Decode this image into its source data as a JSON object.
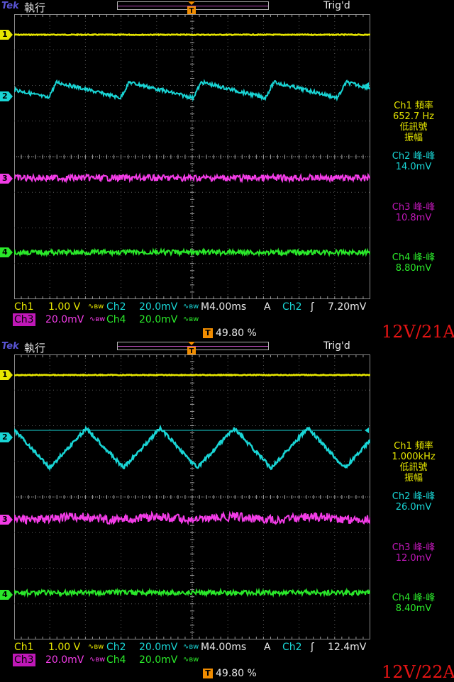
{
  "colors": {
    "ch1": "#e6e600",
    "ch2": "#19d5d5",
    "ch3": "#f23ce6",
    "ch4": "#2ae82a",
    "trigger_marker": "#f08c00",
    "caption": "#e41414"
  },
  "screens": [
    {
      "brand": "Tek",
      "run_state": "執行",
      "trig_status": "Trig'd",
      "channel_markers": [
        "1",
        "2",
        "3",
        "4"
      ],
      "measurements": {
        "ch1": {
          "title": "Ch1 頻率",
          "value": "652.7 Hz",
          "note1": "低訊號",
          "note2": "振幅"
        },
        "ch2": {
          "title": "Ch2 峰-峰",
          "value": "14.0mV"
        },
        "ch3": {
          "title": "Ch3 峰-峰",
          "value": "10.8mV"
        },
        "ch4": {
          "title": "Ch4 峰-峰",
          "value": "8.80mV"
        }
      },
      "status": {
        "ch1_label": "Ch1",
        "ch1_scale": "1.00 V",
        "ch2_label": "Ch2",
        "ch2_scale": "20.0mV",
        "timebase": "M4.00ms",
        "trigger_mode": "A",
        "trigger_source": "Ch2",
        "trigger_level": "7.20mV",
        "ch3_label": "Ch3",
        "ch3_scale": "20.0mV",
        "ch4_label": "Ch4",
        "ch4_scale": "20.0mV",
        "bw_symbol": "∿ʙᴡ",
        "trigger_position": "49.80 %",
        "trigger_badge": "T"
      },
      "caption": "12V/21A",
      "waveform": {
        "ch2_shape": "sawtooth",
        "ch2_pp_mv": 14.0,
        "frequency_hz": 652.7
      }
    },
    {
      "brand": "Tek",
      "run_state": "執行",
      "trig_status": "Trig'd",
      "channel_markers": [
        "1",
        "2",
        "3",
        "4"
      ],
      "measurements": {
        "ch1": {
          "title": "Ch1 頻率",
          "value": "1.000kHz",
          "note1": "低訊號",
          "note2": "振幅"
        },
        "ch2": {
          "title": "Ch2 峰-峰",
          "value": "26.0mV"
        },
        "ch3": {
          "title": "Ch3 峰-峰",
          "value": "12.0mV"
        },
        "ch4": {
          "title": "Ch4 峰-峰",
          "value": "8.40mV"
        }
      },
      "status": {
        "ch1_label": "Ch1",
        "ch1_scale": "1.00 V",
        "ch2_label": "Ch2",
        "ch2_scale": "20.0mV",
        "timebase": "M4.00ms",
        "trigger_mode": "A",
        "trigger_source": "Ch2",
        "trigger_level": "12.4mV",
        "ch3_label": "Ch3",
        "ch3_scale": "20.0mV",
        "ch4_label": "Ch4",
        "ch4_scale": "20.0mV",
        "bw_symbol": "∿ʙᴡ",
        "trigger_position": "49.80 %",
        "trigger_badge": "T"
      },
      "caption": "12V/22A",
      "waveform": {
        "ch2_shape": "triangle",
        "ch2_pp_mv": 26.0,
        "frequency_hz": 1000
      }
    }
  ]
}
